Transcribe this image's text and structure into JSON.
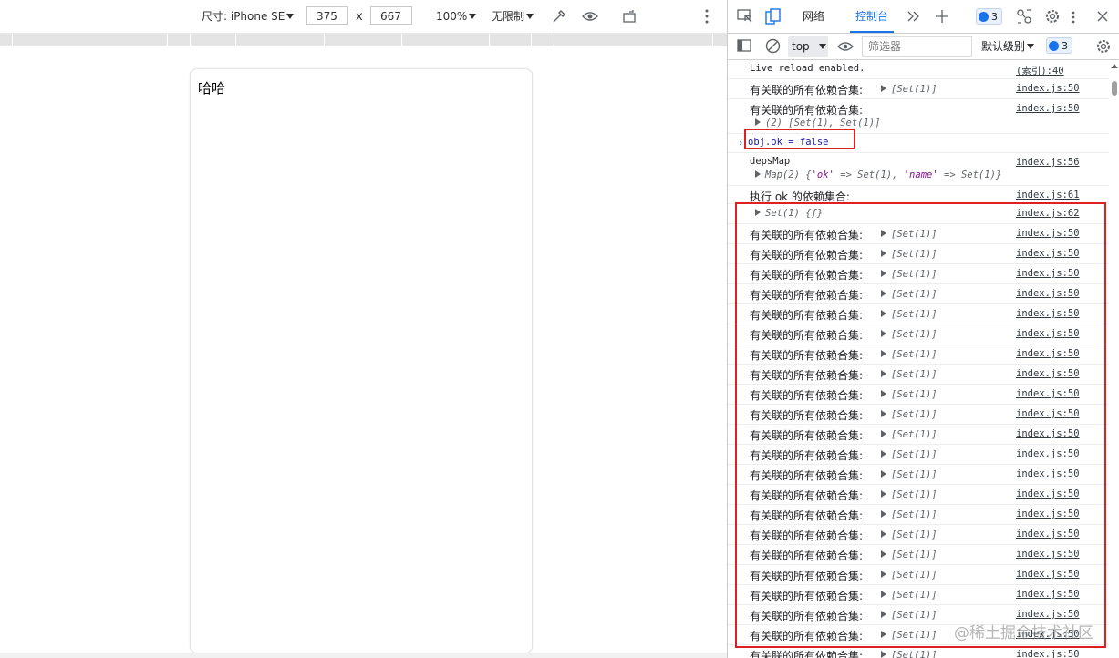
{
  "device_toolbar": {
    "dimensions_label": "尺寸: iPhone SE",
    "width": "375",
    "times": "x",
    "height": "667",
    "zoom": "100%",
    "throttle": "无限制"
  },
  "viewport": {
    "text": "哈哈"
  },
  "devtools": {
    "tabs": [
      {
        "label": "网络",
        "active": false
      },
      {
        "label": "控制台",
        "active": true
      }
    ],
    "issues_badge": "3"
  },
  "console_toolbar": {
    "context": "top",
    "filter_placeholder": "筛选器",
    "levels": "默认级别",
    "messages_badge": "3"
  },
  "console": {
    "live_reload": {
      "text": "Live reload enabled.",
      "source": "(索引):40"
    },
    "first_logs": [
      {
        "text": "有关联的所有依赖合集:",
        "value": "[Set(1)]",
        "source": "index.js:50"
      },
      {
        "text": "有关联的所有依赖合集:",
        "value": "(2) [Set(1), Set(1)]",
        "source": "index.js:50"
      }
    ],
    "command": "obj.ok = false",
    "deps_map": {
      "label": "depsMap",
      "source": "index.js:56",
      "value_prefix": "Map(2) {",
      "key1": "'ok'",
      "arrow1": " => Set(1), ",
      "key2": "'name'",
      "arrow2": " => Set(1)}"
    },
    "exec_log": {
      "text": "执行 ok 的依赖集合:",
      "source": "index.js:61"
    },
    "set_log": {
      "value": "Set(1) {ƒ}",
      "source": "index.js:62"
    },
    "repeated_log": {
      "text": "有关联的所有依赖合集:",
      "value": "[Set(1)]",
      "source": "index.js:50"
    },
    "repeat_count": 22
  },
  "watermark": "@稀土掘金技术社区"
}
